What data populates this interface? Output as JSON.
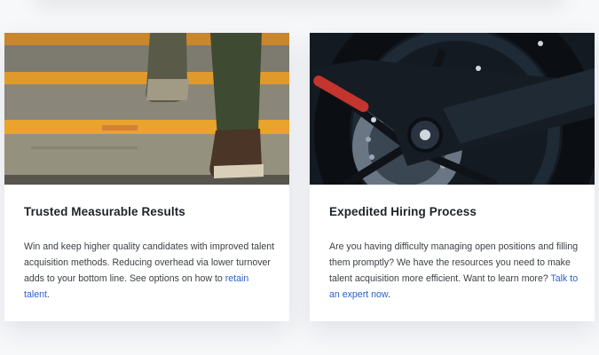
{
  "cards": [
    {
      "image_alt": "feet climbing yellow-striped stairs",
      "title": "Trusted Measurable Results",
      "body": "Win and keep higher quality candidates with improved talent acquisition methods. Reducing overhead via lower turnover adds to your bottom line. See options on how to ",
      "link_text": "retain talent",
      "trailing": "."
    },
    {
      "image_alt": "close-up of motorcycle rear wheel and brake disc",
      "title": "Expedited Hiring Process",
      "body": "Are you having difficulty managing open positions and filling them promptly? We have the resources you need to make talent acquisition more efficient. Want to learn more? ",
      "link_text": "Talk to an expert now",
      "trailing": "."
    }
  ],
  "colors": {
    "link": "#2c61c9",
    "stair_stripe": "#e8a42c",
    "wheel_accent": "#c3352e"
  }
}
